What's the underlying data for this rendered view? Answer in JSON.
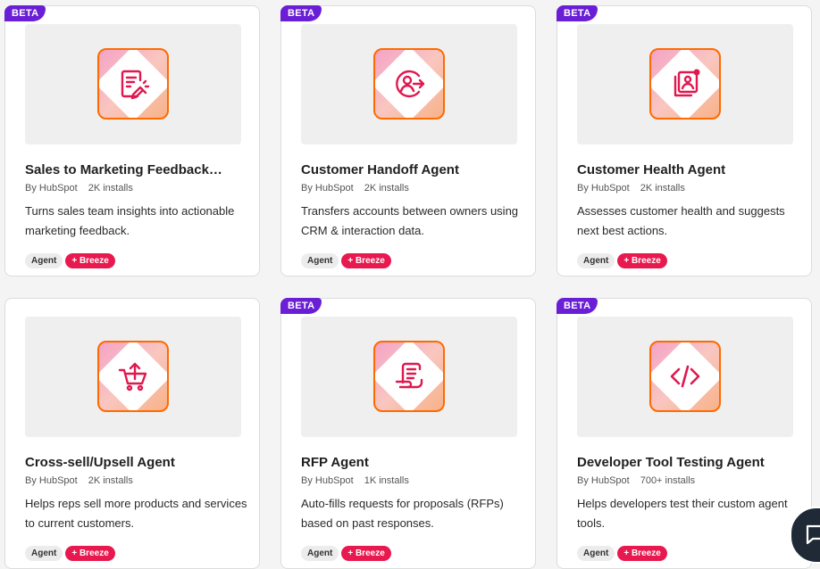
{
  "colors": {
    "beta": "#6a1fd6",
    "breeze": "#e8194f",
    "icon": "#e0184f",
    "tile_border": "#ff6a00"
  },
  "cards": [
    {
      "title": "Sales to Marketing Feedback…",
      "by": "By HubSpot",
      "installs": "2K installs",
      "description": "Turns sales team insights into actionable marketing feedback.",
      "badge": "BETA",
      "tags": [
        "Agent",
        "+ Breeze"
      ],
      "icon": "feedback-icon"
    },
    {
      "title": "Customer Handoff Agent",
      "by": "By HubSpot",
      "installs": "2K installs",
      "description": "Transfers accounts between owners using CRM & interaction data.",
      "badge": "BETA",
      "tags": [
        "Agent",
        "+ Breeze"
      ],
      "icon": "handoff-icon"
    },
    {
      "title": "Customer Health Agent",
      "by": "By HubSpot",
      "installs": "2K installs",
      "description": "Assesses customer health and suggests next best actions.",
      "badge": "BETA",
      "tags": [
        "Agent",
        "+ Breeze"
      ],
      "icon": "health-icon"
    },
    {
      "title": "Cross-sell/Upsell Agent",
      "by": "By HubSpot",
      "installs": "2K installs",
      "description": "Helps reps sell more products and services to current customers.",
      "badge": "",
      "tags": [
        "Agent",
        "+ Breeze"
      ],
      "icon": "cart-upload-icon"
    },
    {
      "title": "RFP Agent",
      "by": "By HubSpot",
      "installs": "1K installs",
      "description": "Auto-fills requests for proposals (RFPs) based on past responses.",
      "badge": "BETA",
      "tags": [
        "Agent",
        "+ Breeze"
      ],
      "icon": "document-hand-icon"
    },
    {
      "title": "Developer Tool Testing Agent",
      "by": "By HubSpot",
      "installs": "700+ installs",
      "description": "Helps developers test their custom agent tools.",
      "badge": "BETA",
      "tags": [
        "Agent",
        "+ Breeze"
      ],
      "icon": "code-icon"
    }
  ],
  "chat_button": {
    "icon": "chat-icon"
  }
}
